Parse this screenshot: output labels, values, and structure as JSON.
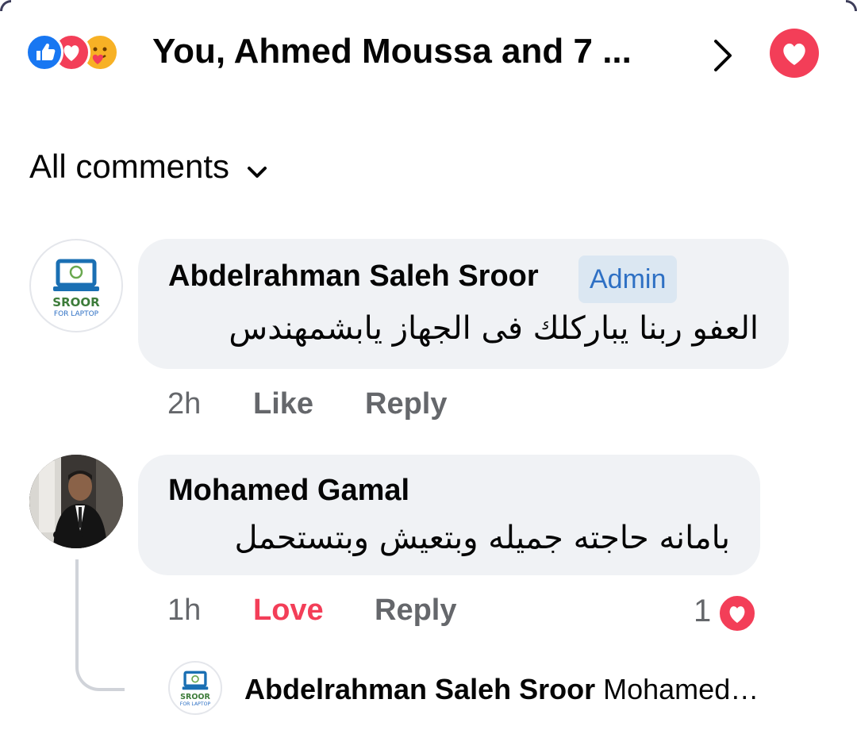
{
  "reactions": {
    "summary_text": "You, Ahmed Moussa and 7 ...",
    "icons": [
      "like-icon",
      "love-icon",
      "care-icon"
    ]
  },
  "filter": {
    "label": "All comments"
  },
  "comments": [
    {
      "author": "Abdelrahman Saleh Sroor",
      "badge": "Admin",
      "text": "العفو ربنا يباركلك فى الجهاز يابشمهندس",
      "time": "2h",
      "like_label": "Like",
      "reply_label": "Reply",
      "avatar_logo": {
        "line1": "SROOR",
        "line2": "FOR LAPTOP"
      }
    },
    {
      "author": "Mohamed Gamal",
      "text": "بامانه حاجته جميله وبتعيش وبتستحمل",
      "time": "1h",
      "reaction_label": "Love",
      "reply_label": "Reply",
      "reaction_count": "1"
    }
  ],
  "reply_preview": {
    "author": "Abdelrahman Saleh Sroor",
    "text": "Mohamed…",
    "avatar_logo": {
      "line1": "SROOR",
      "line2": "FOR LAPTOP"
    }
  },
  "colors": {
    "like_blue": "#1877f2",
    "love_red": "#f33e58",
    "care_yellow": "#f7b125",
    "admin_blue": "#2e70c4",
    "bubble_gray": "#f0f2f5",
    "meta_gray": "#65676b"
  }
}
